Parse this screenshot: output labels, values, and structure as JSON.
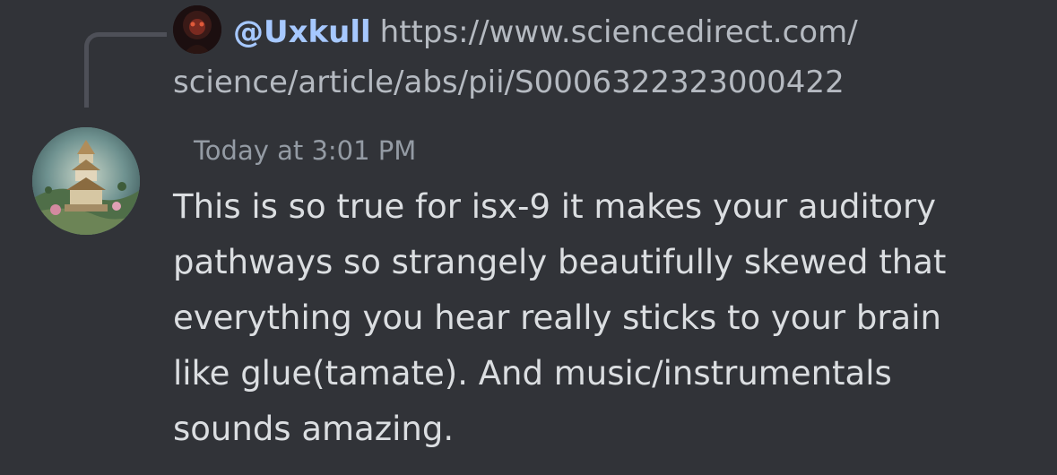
{
  "reply": {
    "author": "@Uxkull",
    "link_line1": "https://www.sciencedirect.com/",
    "link_line2": "science/article/abs/pii/S0006322323000422"
  },
  "message": {
    "timestamp": "Today at 3:01 PM",
    "lines": [
      "This is so true for isx-9 it makes your auditory",
      "pathways so strangely beautifully skewed that",
      "everything you hear really sticks to your brain",
      "like glue(tamate). And music/instrumentals",
      "sounds amazing."
    ]
  },
  "colors": {
    "background": "#313338",
    "author": "#a6c8ff",
    "muted": "#b5bac1",
    "timestamp": "#949ba4",
    "text": "#dbdee1"
  }
}
